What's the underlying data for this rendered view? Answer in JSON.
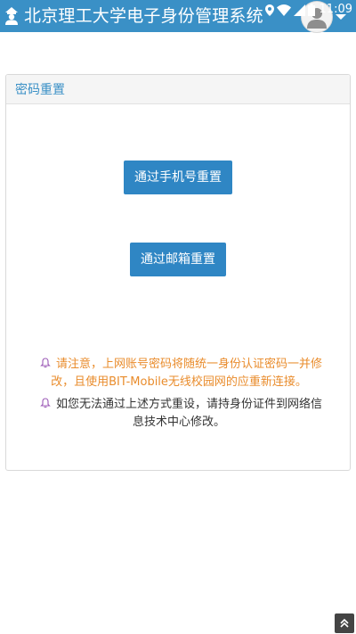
{
  "header": {
    "title": "北京理工大学电子身份管理系统",
    "status_time": "11:09"
  },
  "panel": {
    "title": "密码重置",
    "buttons": {
      "phone_reset": "通过手机号重置",
      "email_reset": "通过邮箱重置"
    },
    "notices": [
      {
        "line1": "请注意，上网账号密码将随统一身份认证密码一并修",
        "line2": "改，且使用BIT-Mobile无线校园网的应重新连接。"
      },
      {
        "line1": "如您无法通过上述方式重设，请持身份证件到网络信",
        "line2": "息技术中心修改。"
      }
    ]
  },
  "colors": {
    "brand": "#3a90c6",
    "button": "#2f86c4",
    "warning_text": "#e98c2c",
    "bell_icon": "#9b59b6"
  },
  "icons": [
    "home-user-icon",
    "location-icon",
    "wifi-icon",
    "signal-icon",
    "battery-icon",
    "avatar-icon",
    "caret-down-icon",
    "bell-icon",
    "scroll-to-top-icon"
  ]
}
